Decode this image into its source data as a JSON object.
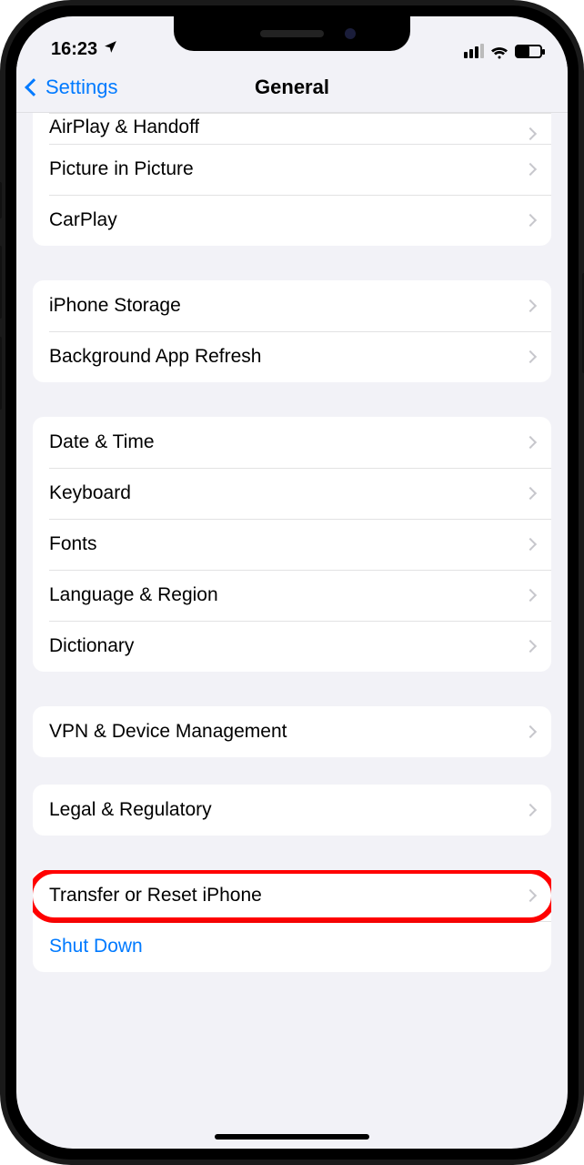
{
  "status": {
    "time": "16:23"
  },
  "nav": {
    "back_label": "Settings",
    "title": "General"
  },
  "groups": [
    {
      "id": "g1",
      "rows": [
        {
          "id": "airplay",
          "label": "AirPlay & Handoff",
          "disclosure": true,
          "cutoff": true
        },
        {
          "id": "pip",
          "label": "Picture in Picture",
          "disclosure": true
        },
        {
          "id": "carplay",
          "label": "CarPlay",
          "disclosure": true
        }
      ]
    },
    {
      "id": "g2",
      "rows": [
        {
          "id": "storage",
          "label": "iPhone Storage",
          "disclosure": true
        },
        {
          "id": "bg-refresh",
          "label": "Background App Refresh",
          "disclosure": true
        }
      ]
    },
    {
      "id": "g3",
      "rows": [
        {
          "id": "datetime",
          "label": "Date & Time",
          "disclosure": true
        },
        {
          "id": "keyboard",
          "label": "Keyboard",
          "disclosure": true
        },
        {
          "id": "fonts",
          "label": "Fonts",
          "disclosure": true
        },
        {
          "id": "language",
          "label": "Language & Region",
          "disclosure": true
        },
        {
          "id": "dictionary",
          "label": "Dictionary",
          "disclosure": true
        }
      ]
    },
    {
      "id": "g4",
      "rows": [
        {
          "id": "vpn",
          "label": "VPN & Device Management",
          "disclosure": true
        }
      ]
    },
    {
      "id": "g5",
      "rows": [
        {
          "id": "legal",
          "label": "Legal & Regulatory",
          "disclosure": true
        }
      ]
    },
    {
      "id": "g6",
      "rows": [
        {
          "id": "transfer-reset",
          "label": "Transfer or Reset iPhone",
          "disclosure": true,
          "highlight": true
        },
        {
          "id": "shutdown",
          "label": "Shut Down",
          "link": true
        }
      ]
    }
  ]
}
